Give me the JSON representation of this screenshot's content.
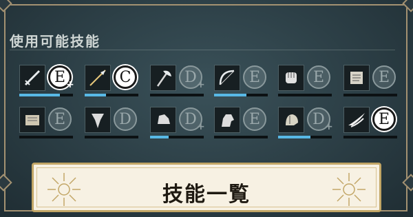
{
  "section_title": "使用可能技能",
  "banner_title": "技能一覧",
  "colors": {
    "accent_bar": "#58b9e6",
    "frame_gold": "#a49272",
    "banner_bg": "#f7f1e3"
  },
  "skills": [
    {
      "icon": "sword-icon",
      "rank": "E",
      "rank_active": true,
      "plus": "+",
      "progress": 0.75
    },
    {
      "icon": "lance-icon",
      "rank": "C",
      "rank_active": true,
      "plus": "",
      "progress": 0.4
    },
    {
      "icon": "axe-icon",
      "rank": "D",
      "rank_active": false,
      "plus": "+",
      "progress": 0.0
    },
    {
      "icon": "bow-icon",
      "rank": "E",
      "rank_active": false,
      "plus": "",
      "progress": 0.6
    },
    {
      "icon": "brawl-icon",
      "rank": "E",
      "rank_active": false,
      "plus": "",
      "progress": 0.0
    },
    {
      "icon": "reason-tome-icon",
      "rank": "E",
      "rank_active": false,
      "plus": "",
      "progress": 0.0
    },
    {
      "icon": "faith-tome-icon",
      "rank": "E",
      "rank_active": false,
      "plus": "",
      "progress": 0.0
    },
    {
      "icon": "authority-banner-icon",
      "rank": "D",
      "rank_active": false,
      "plus": "",
      "progress": 0.0
    },
    {
      "icon": "heavy-armor-icon",
      "rank": "D",
      "rank_active": false,
      "plus": "+",
      "progress": 0.35
    },
    {
      "icon": "riding-horse-icon",
      "rank": "E",
      "rank_active": false,
      "plus": "",
      "progress": 0.0
    },
    {
      "icon": "helmet-icon",
      "rank": "D",
      "rank_active": false,
      "plus": "+",
      "progress": 0.6
    },
    {
      "icon": "flying-wing-icon",
      "rank": "E",
      "rank_active": true,
      "plus": "",
      "progress": 0.0
    }
  ]
}
